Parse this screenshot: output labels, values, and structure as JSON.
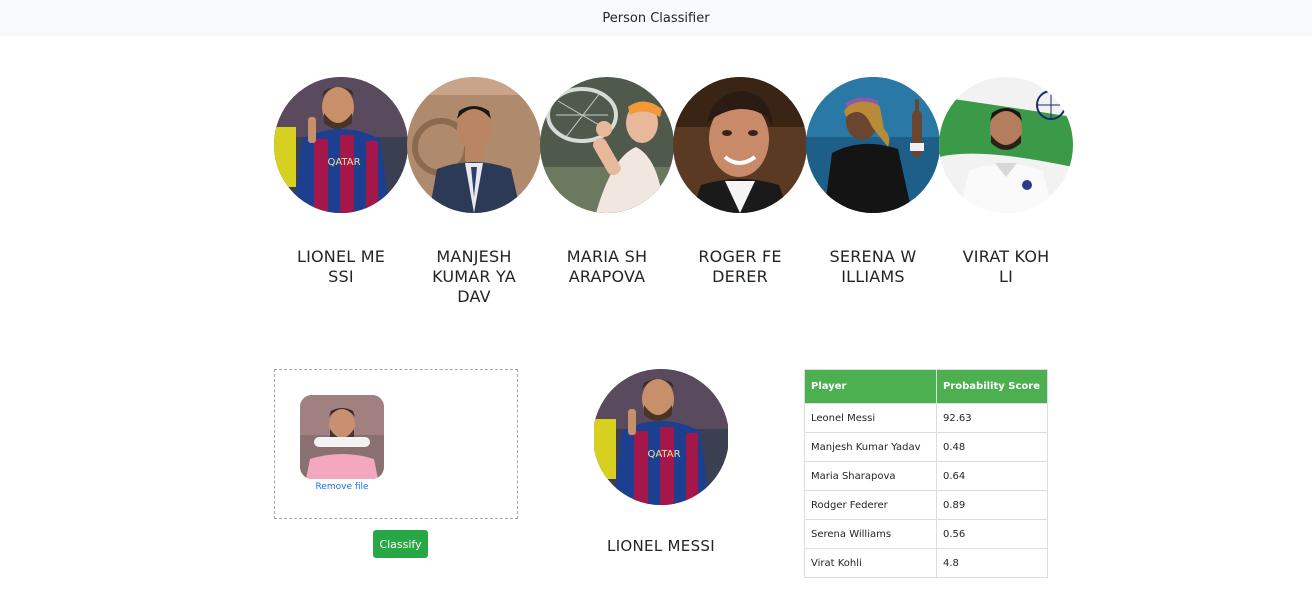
{
  "navbar": {
    "title": "Person Classifier"
  },
  "gallery": [
    {
      "name": "LIONEL MESSI"
    },
    {
      "name": "MANJESH KUMAR YADAV"
    },
    {
      "name": "MARIA SHARAPOVA"
    },
    {
      "name": "ROGER FEDERER"
    },
    {
      "name": "SERENA WILLIAMS"
    },
    {
      "name": "VIRAT KOHLI"
    }
  ],
  "upload": {
    "remove_label": "Remove file"
  },
  "classify_button": "Classify",
  "result": {
    "name": "LIONEL MESSI"
  },
  "table": {
    "headers": [
      "Player",
      "Probability Score"
    ],
    "rows": [
      [
        "Leonel Messi",
        "92.63"
      ],
      [
        "Manjesh Kumar Yadav",
        "0.48"
      ],
      [
        "Maria Sharapova",
        "0.64"
      ],
      [
        "Rodger Federer",
        "0.89"
      ],
      [
        "Serena Williams",
        "0.56"
      ],
      [
        "Virat Kohli",
        "4.8"
      ]
    ]
  },
  "colors": {
    "accent_green": "#4caf50",
    "button_green": "#28a745",
    "link_blue": "#1a73e8",
    "navbar_bg": "#f8f9fa"
  }
}
